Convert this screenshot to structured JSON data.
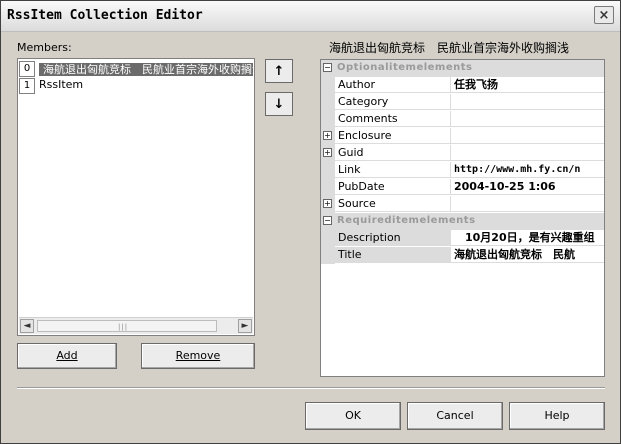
{
  "window": {
    "title": "RssItem Collection Editor",
    "close_label": "×"
  },
  "members": {
    "label": "Members:",
    "items": [
      {
        "index": "0",
        "text": "海航退出匈航竞标　民航业首宗海外收购搁浅"
      },
      {
        "index": "1",
        "text": "RssItem"
      }
    ],
    "scroll_left": "◄",
    "scroll_right": "►",
    "scroll_grip": "|||"
  },
  "move_buttons": {
    "up": "↑",
    "down": "↓"
  },
  "buttons": {
    "add": "Add",
    "remove": "Remove",
    "ok": "OK",
    "cancel": "Cancel",
    "help": "Help"
  },
  "properties": {
    "header": "海航退出匈航竞标　民航业首宗海外收购搁浅",
    "categories": [
      {
        "name": "Optionalitemelements",
        "expander": "⊟",
        "rows": [
          {
            "name": "Author",
            "value": "任我飞扬",
            "expander": ""
          },
          {
            "name": "Category",
            "value": "",
            "expander": ""
          },
          {
            "name": "Comments",
            "value": "",
            "expander": ""
          },
          {
            "name": "Enclosure",
            "value": "",
            "expander": "+"
          },
          {
            "name": "Guid",
            "value": "",
            "expander": "+"
          },
          {
            "name": "Link",
            "value": "http://www.mh.fy.cn/n",
            "expander": ""
          },
          {
            "name": "PubDate",
            "value": "2004-10-25 1:06",
            "expander": ""
          },
          {
            "name": "Source",
            "value": "",
            "expander": "+"
          }
        ]
      },
      {
        "name": "Requireditemelements",
        "expander": "⊟",
        "rows": [
          {
            "name": "Description",
            "value": "　10月20日，是有兴趣重组",
            "expander": ""
          },
          {
            "name": "Title",
            "value": "海航退出匈航竞标　民航",
            "expander": ""
          }
        ]
      }
    ]
  }
}
